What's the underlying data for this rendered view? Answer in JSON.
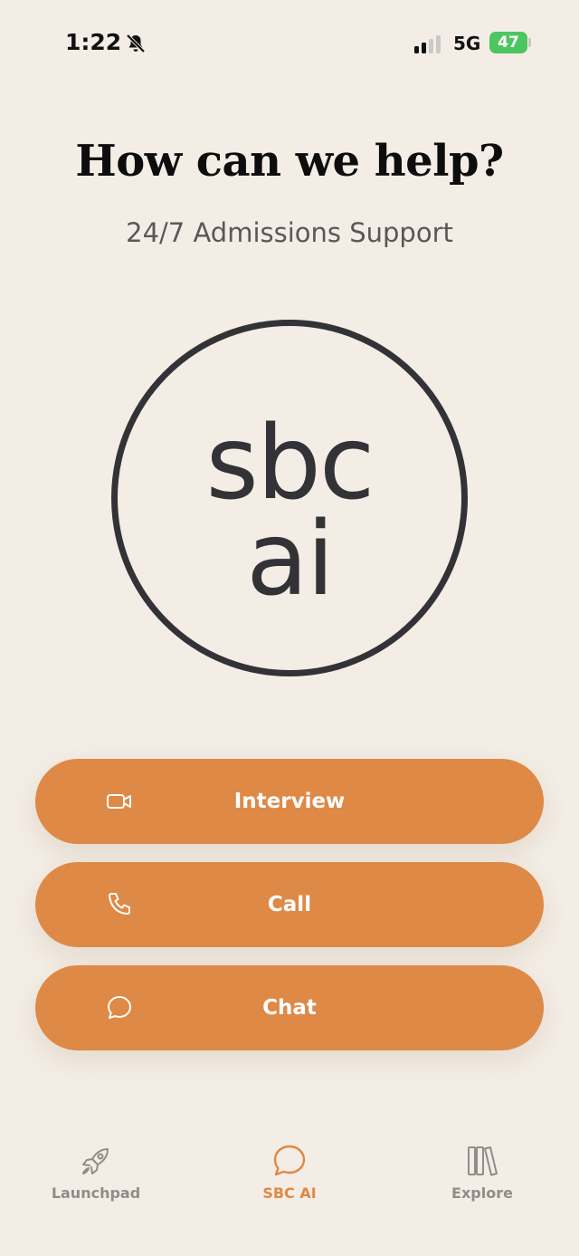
{
  "status_bar": {
    "time": "1:22",
    "network": "5G",
    "battery": "47",
    "battery_color": "#4cc660"
  },
  "header": {
    "title": "How can we help?",
    "subtitle": "24/7 Admissions Support"
  },
  "logo": {
    "line1": "sbc",
    "line2": "ai"
  },
  "actions": [
    {
      "label": "Interview",
      "icon": "video-camera-icon"
    },
    {
      "label": "Call",
      "icon": "phone-icon"
    },
    {
      "label": "Chat",
      "icon": "chat-bubble-icon"
    }
  ],
  "tab_bar": {
    "items": [
      {
        "label": "Launchpad",
        "icon": "rocket-icon",
        "active": false
      },
      {
        "label": "SBC AI",
        "icon": "chat-bubble-icon",
        "active": true
      },
      {
        "label": "Explore",
        "icon": "books-icon",
        "active": false
      }
    ]
  },
  "colors": {
    "background": "#f3ede5",
    "accent": "#de8946",
    "logo": "#333236",
    "inactive_tab": "#8f8d8a"
  }
}
